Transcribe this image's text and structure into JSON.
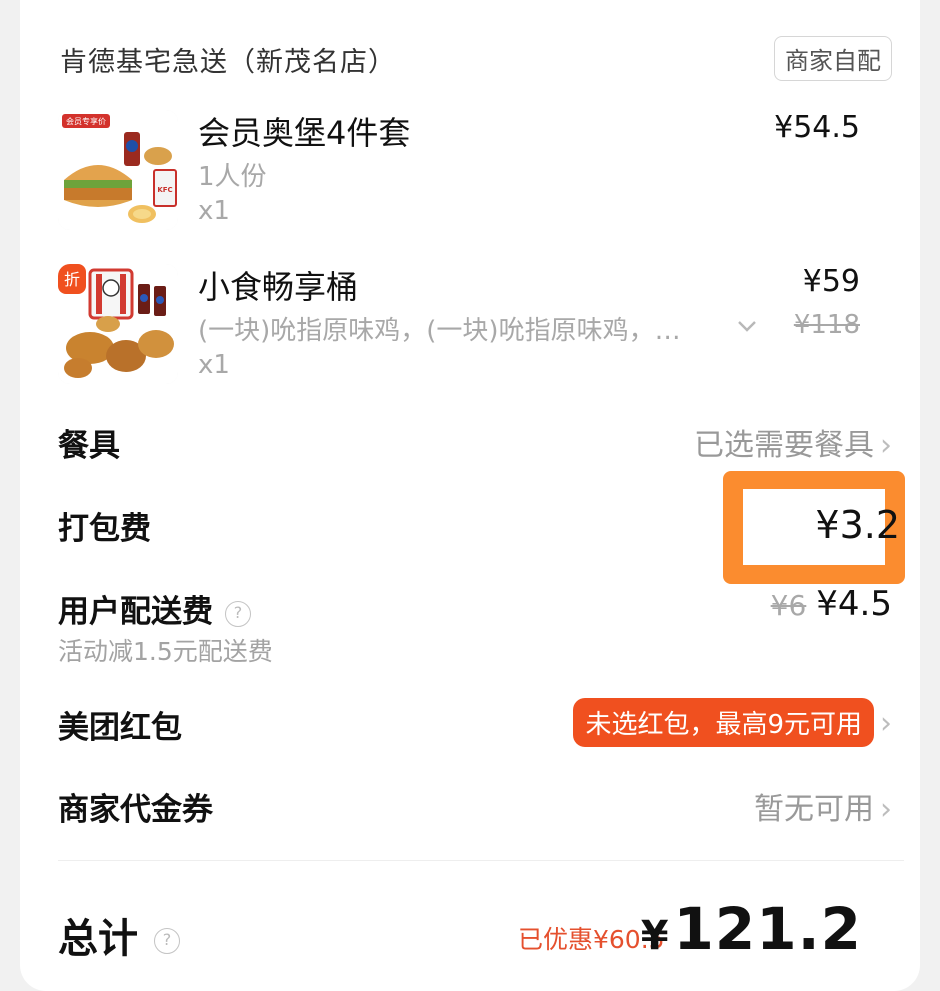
{
  "store": {
    "name": "肯德基宅急送（新茂名店）",
    "delivery_tag": "商家自配"
  },
  "items": [
    {
      "name": "会员奥堡4件套",
      "sub": "1人份",
      "qty": "x1",
      "price": "¥54.5",
      "badge": "会员专享价",
      "image": "kfc-burger-combo-image"
    },
    {
      "name": "小食畅享桶",
      "sub": "(一块)吮指原味鸡，(一块)吮指原味鸡，…",
      "qty": "x1",
      "price": "¥59",
      "old_price": "¥118",
      "badge": "折",
      "image": "kfc-bucket-image"
    }
  ],
  "tableware": {
    "label": "餐具",
    "value": "已选需要餐具"
  },
  "packing": {
    "label": "打包费",
    "value": "¥3.2"
  },
  "delivery": {
    "label": "用户配送费",
    "old_price": "¥6",
    "price": "¥4.5",
    "note": "活动减1.5元配送费"
  },
  "redpacket": {
    "label": "美团红包",
    "value": "未选红包，最高9元可用"
  },
  "voucher": {
    "label": "商家代金券",
    "value": "暂无可用"
  },
  "total": {
    "label": "总计",
    "saved": "已优惠¥60.5",
    "currency": "¥",
    "amount": "121.2"
  },
  "colors": {
    "accent": "#f0501f",
    "highlight": "#fb8c2f",
    "muted": "#999999"
  }
}
